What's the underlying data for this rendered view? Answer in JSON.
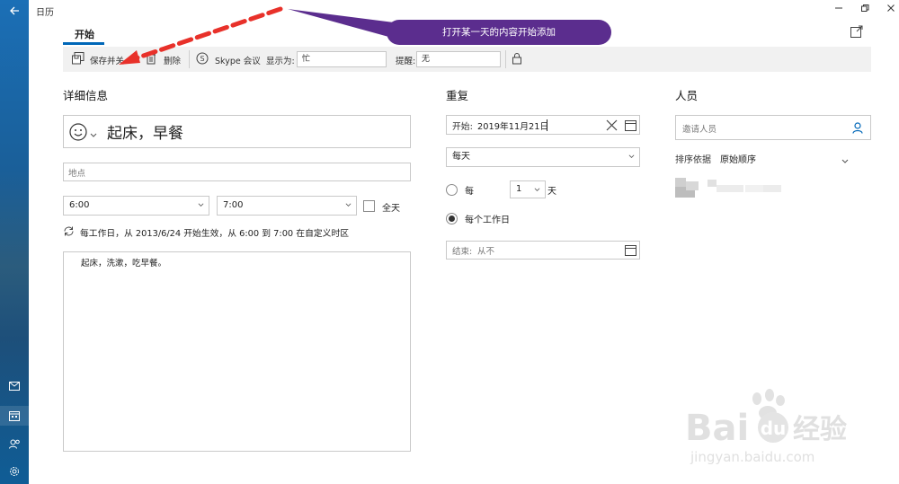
{
  "app": {
    "title": "日历"
  },
  "tabs": {
    "start": "开始"
  },
  "toolbar": {
    "save_close": "保存并关",
    "delete": "删除",
    "skype": "Skype 会议",
    "show_as_label": "显示为:",
    "show_as_value": "忙",
    "reminder_label": "提醒:",
    "reminder_value": "无"
  },
  "details": {
    "title": "详细信息",
    "event_title": "起床，早餐",
    "location_placeholder": "地点",
    "start_time": "6:00",
    "end_time": "7:00",
    "all_day": "全天",
    "recurrence_summary": "每工作日，从 2013/6/24 开始生效，从 6:00 到 7:00 在自定义时区",
    "description": "起床，洗漱，吃早餐。"
  },
  "repeat": {
    "title": "重复",
    "start_label": "开始:",
    "start_date": "2019年11月21日",
    "frequency": "每天",
    "every_label": "每",
    "every_value": "1",
    "every_unit": "天",
    "every_workday": "每个工作日",
    "end_label": "结束:",
    "end_value": "从不"
  },
  "people": {
    "title": "人员",
    "invite_placeholder": "邀请人员",
    "sort_label": "排序依据",
    "sort_value": "原始顺序"
  },
  "annotation": {
    "callout": "打开某一天的内容开始添加"
  },
  "colors": {
    "accent": "#0067b8",
    "callout": "#5b2d8e",
    "arrow": "#e8312a"
  },
  "icons": [
    "back-arrow-icon",
    "mail-icon",
    "calendar-icon",
    "people-icon",
    "settings-icon",
    "save-icon",
    "trash-icon",
    "skype-icon",
    "lock-icon",
    "emoji-icon",
    "recurrence-icon",
    "clear-icon",
    "calendar-picker-icon",
    "person-icon",
    "chevron-down-icon"
  ]
}
